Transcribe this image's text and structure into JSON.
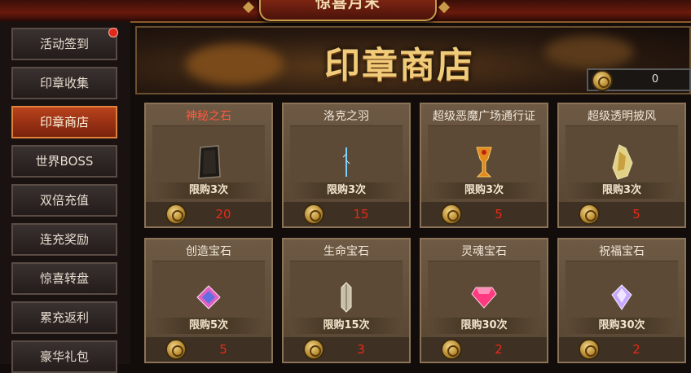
{
  "header": {
    "title": "惊喜月末"
  },
  "sidebar": {
    "items": [
      {
        "label": "活动签到"
      },
      {
        "label": "印章收集"
      },
      {
        "label": "印章商店"
      },
      {
        "label": "世界BOSS"
      },
      {
        "label": "双倍充值"
      },
      {
        "label": "连充奖励"
      },
      {
        "label": "惊喜转盘"
      },
      {
        "label": "累充返利"
      },
      {
        "label": "豪华礼包"
      }
    ]
  },
  "shop": {
    "title": "印章商店",
    "balance": "0",
    "items": [
      {
        "name": "神秘之石",
        "limit": "限购3次",
        "price": "20",
        "icon": "dark-stone-icon"
      },
      {
        "name": "洛克之羽",
        "limit": "限购3次",
        "price": "15",
        "icon": "blue-feather-icon"
      },
      {
        "name": "超级恶魔广场通行证",
        "limit": "限购3次",
        "price": "5",
        "icon": "golden-goblet-icon"
      },
      {
        "name": "超级透明披风",
        "limit": "限购3次",
        "price": "5",
        "icon": "glowing-cloak-icon"
      },
      {
        "name": "创造宝石",
        "limit": "限购5次",
        "price": "5",
        "icon": "creation-gem-icon"
      },
      {
        "name": "生命宝石",
        "limit": "限购15次",
        "price": "3",
        "icon": "life-gem-icon"
      },
      {
        "name": "灵魂宝石",
        "limit": "限购30次",
        "price": "2",
        "icon": "soul-gem-icon"
      },
      {
        "name": "祝福宝石",
        "limit": "限购30次",
        "price": "2",
        "icon": "blessing-gem-icon"
      }
    ]
  },
  "colors": {
    "active_tab": "#b8421c",
    "price": "#e82a1a",
    "title_gold": "#f0cc7a"
  }
}
